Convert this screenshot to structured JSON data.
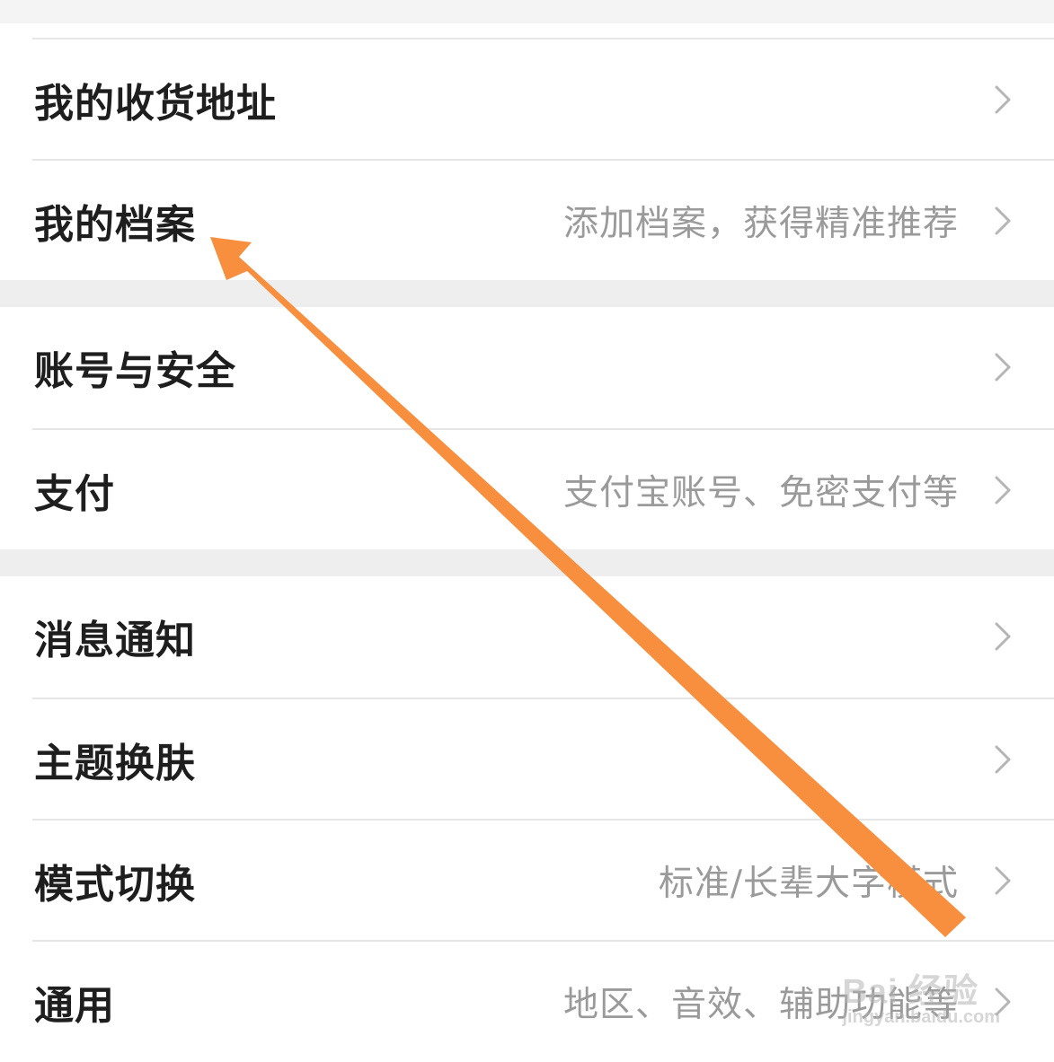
{
  "settings": {
    "rows": [
      {
        "title": "我的收货地址",
        "subtitle": ""
      },
      {
        "title": "我的档案",
        "subtitle": "添加档案，获得精准推荐"
      },
      {
        "title": "账号与安全",
        "subtitle": ""
      },
      {
        "title": "支付",
        "subtitle": "支付宝账号、免密支付等"
      },
      {
        "title": "消息通知",
        "subtitle": ""
      },
      {
        "title": "主题换肤",
        "subtitle": ""
      },
      {
        "title": "模式切换",
        "subtitle": "标准/长辈大字模式"
      },
      {
        "title": "通用",
        "subtitle": "地区、音效、辅助功能等"
      }
    ]
  },
  "annotation": {
    "arrow_color": "#f78f3f",
    "icon": "arrow-annotation-icon"
  },
  "watermark": {
    "main": "Bai 经验",
    "sub": "jingyan.baidu.com"
  },
  "colors": {
    "title": "#1e1e1e",
    "subtitle": "#9a9a9a",
    "chevron": "#b5b5b5",
    "gap": "#eeeeee"
  }
}
